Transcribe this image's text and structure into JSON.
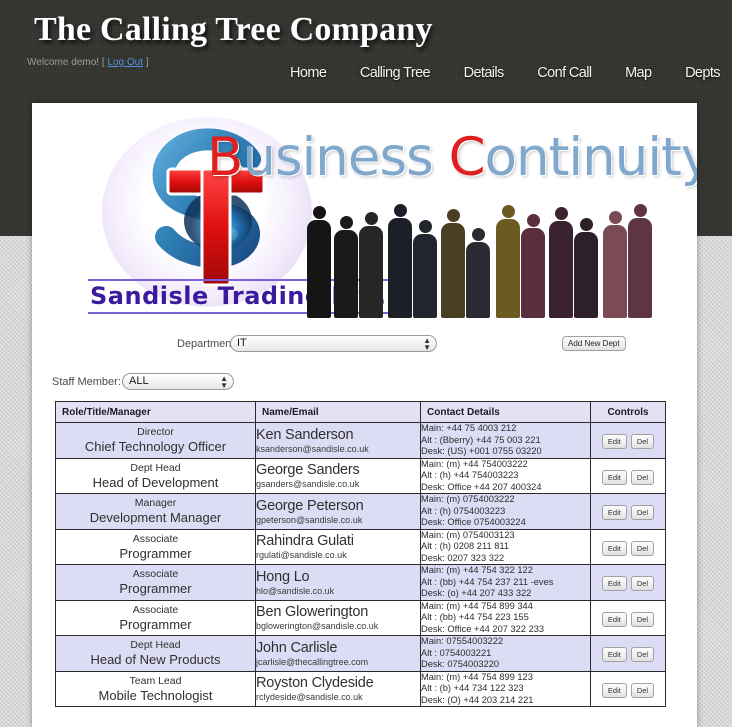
{
  "header": {
    "site_title": "The Calling Tree Company",
    "welcome_prefix": "Welcome demo!",
    "bracket_open": "[",
    "logout_label": "Log Out",
    "bracket_close": "]",
    "nav": [
      {
        "label": "Home"
      },
      {
        "label": "Calling Tree"
      },
      {
        "label": "Details"
      },
      {
        "label": "Conf Call"
      },
      {
        "label": "Map"
      },
      {
        "label": "Depts"
      }
    ]
  },
  "banner": {
    "heading_word1_cap": "B",
    "heading_word1_rest": "usiness",
    "heading_space": " ",
    "heading_word2_cap": "C",
    "heading_word2_rest": "ontinuity",
    "logo_text": "Sandisle Trading Ltd.",
    "logo_letter_s": "S",
    "logo_letter_t": "T",
    "colors": {
      "accent_red": "#e02020",
      "accent_blue": "#7fa8cc",
      "logo_purple": "#3b1a9e",
      "logo_s_blue": "#3d92c8"
    }
  },
  "filters": {
    "department_label": "Department:",
    "department_value": "IT",
    "department_options": [
      "IT"
    ],
    "staff_label": "Staff Member:",
    "staff_value": "ALL",
    "staff_options": [
      "ALL"
    ],
    "add_dept_label": "Add New Dept"
  },
  "table": {
    "columns": [
      "Role/Title/Manager",
      "Name/Email",
      "Contact Details",
      "Controls"
    ],
    "edit_label": "Edit",
    "delete_label": "Del",
    "rows": [
      {
        "role": "Director",
        "title": "Chief Technology Officer",
        "name": "Ken Sanderson",
        "email": "ksanderson@sandisle.co.uk",
        "contact_main": "Main: +44 75 4003 212",
        "contact_alt": "Alt : (Bberry) +44 75 003 221",
        "contact_desk": "Desk: (US) +001 0755 03220"
      },
      {
        "role": "Dept Head",
        "title": "Head of Development",
        "name": "George Sanders",
        "email": "gsanders@sandisle.co.uk",
        "contact_main": "Main: (m) +44 754003222",
        "contact_alt": "Alt : (h) +44 754003223",
        "contact_desk": "Desk: Office +44 207 400324"
      },
      {
        "role": "Manager",
        "title": "Development Manager",
        "name": "George Peterson",
        "email": "gpeterson@sandisle.co.uk",
        "contact_main": "Main: (m) 0754003222",
        "contact_alt": "Alt : (h) 0754003223",
        "contact_desk": "Desk: Office 0754003224"
      },
      {
        "role": "Associate",
        "title": "Programmer",
        "name": "Rahindra Gulati",
        "email": "rgulati@sandisle.co.uk",
        "contact_main": "Main: (m) 0754003123",
        "contact_alt": "Alt : (h) 0208 211 811",
        "contact_desk": "Desk: 0207 323 322"
      },
      {
        "role": "Associate",
        "title": "Programmer",
        "name": "Hong Lo",
        "email": "hlo@sandisle.co.uk",
        "contact_main": "Main: (m) +44 754 322 122",
        "contact_alt": "Alt : (bb) +44 754 237 211 -eves",
        "contact_desk": "Desk: (o) +44 207 433 322"
      },
      {
        "role": "Associate",
        "title": "Programmer",
        "name": "Ben Glowerington",
        "email": "bglowerington@sandisle.co.uk",
        "contact_main": "Main: (m) +44 754 899 344",
        "contact_alt": "Alt : (bb) +44 754 223 155",
        "contact_desk": "Desk: Office +44 207 322 233"
      },
      {
        "role": "Dept Head",
        "title": "Head of New Products",
        "name": "John Carlisle",
        "email": "jcarlisle@thecallingtree.com",
        "contact_main": "Main: 07554003222",
        "contact_alt": "Alt : 0754003221",
        "contact_desk": "Desk: 0754003220"
      },
      {
        "role": "Team Lead",
        "title": "Mobile Technologist",
        "name": "Royston Clydeside",
        "email": "rclydeside@sandisle.co.uk",
        "contact_main": "Main: (m) +44 754 899 123",
        "contact_alt": "Alt : (b) +44 734 122 323",
        "contact_desk": "Desk: (O) +44 203 214 221"
      }
    ]
  }
}
